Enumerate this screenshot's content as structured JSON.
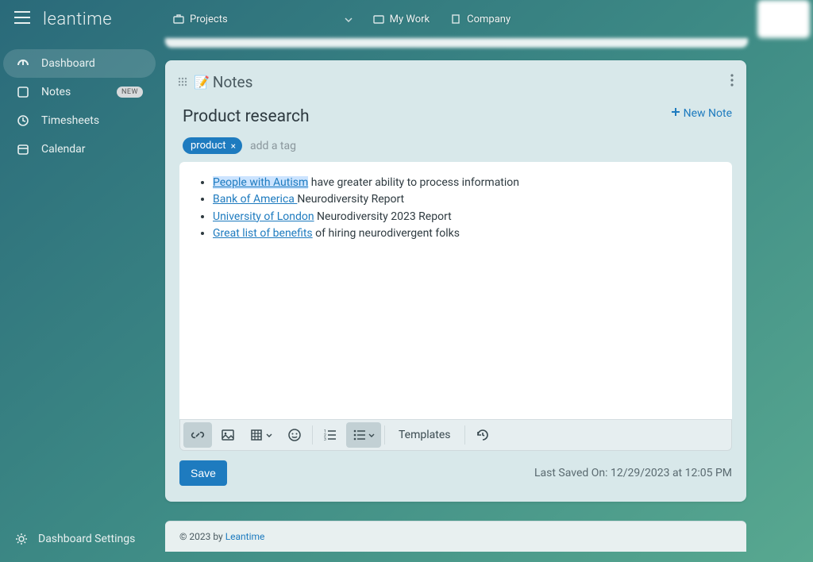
{
  "app_name": "leantime",
  "topbar": {
    "projects": "Projects",
    "mywork": "My Work",
    "company": "Company"
  },
  "sidebar": {
    "items": [
      {
        "label": "Dashboard"
      },
      {
        "label": "Notes",
        "badge": "NEW"
      },
      {
        "label": "Timesheets"
      },
      {
        "label": "Calendar"
      }
    ],
    "settings": "Dashboard Settings"
  },
  "notes_widget": {
    "title": "Notes",
    "emoji": "📝",
    "new_note": "New Note"
  },
  "note": {
    "title": "Product research",
    "tags": [
      "product"
    ],
    "add_tag_placeholder": "add a tag",
    "content": [
      {
        "link": "People with Autism",
        "rest": " have greater ability to process information",
        "selected": true
      },
      {
        "link": "Bank of America ",
        "rest": "Neurodiversity Report"
      },
      {
        "link": "University of London",
        "rest": " Neurodiversity 2023 Report"
      },
      {
        "link": "Great list of benefits",
        "rest": " of hiring neurodivergent folks"
      }
    ]
  },
  "toolbar": {
    "templates": "Templates"
  },
  "actions": {
    "save": "Save",
    "last_saved": "Last Saved On: 12/29/2023 at 12:05 PM"
  },
  "footer": {
    "prefix": "© 2023 by ",
    "link": "Leantime"
  }
}
